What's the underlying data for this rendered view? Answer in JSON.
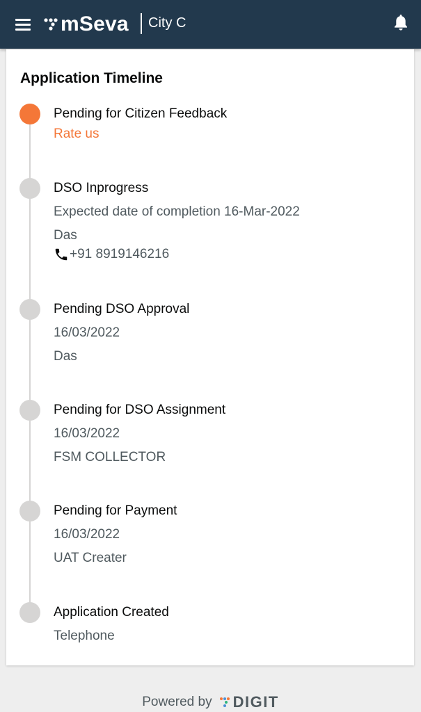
{
  "header": {
    "app_name": "mSeva",
    "city": "City C",
    "menu_icon": "hamburger-menu-icon",
    "notification_icon": "bell-icon",
    "background_color": "#22394d"
  },
  "timeline": {
    "title": "Application Timeline",
    "accent_color": "#f47738",
    "steps": [
      {
        "title": "Pending for Citizen Feedback",
        "action": "Rate us",
        "active": true
      },
      {
        "title": "DSO Inprogress",
        "lines": [
          "Expected date of completion 16-Mar-2022",
          "Das"
        ],
        "phone": "+91 8919146216",
        "phone_icon": "phone-icon"
      },
      {
        "title": "Pending DSO Approval",
        "lines": [
          "16/03/2022",
          "Das"
        ]
      },
      {
        "title": "Pending for DSO Assignment",
        "lines": [
          "16/03/2022",
          "FSM COLLECTOR"
        ]
      },
      {
        "title": "Pending for Payment",
        "lines": [
          "16/03/2022",
          "UAT Creater"
        ]
      },
      {
        "title": "Application Created",
        "lines": [
          "Telephone"
        ]
      }
    ]
  },
  "footer": {
    "powered_by": "Powered by",
    "brand": "DIGIT"
  }
}
